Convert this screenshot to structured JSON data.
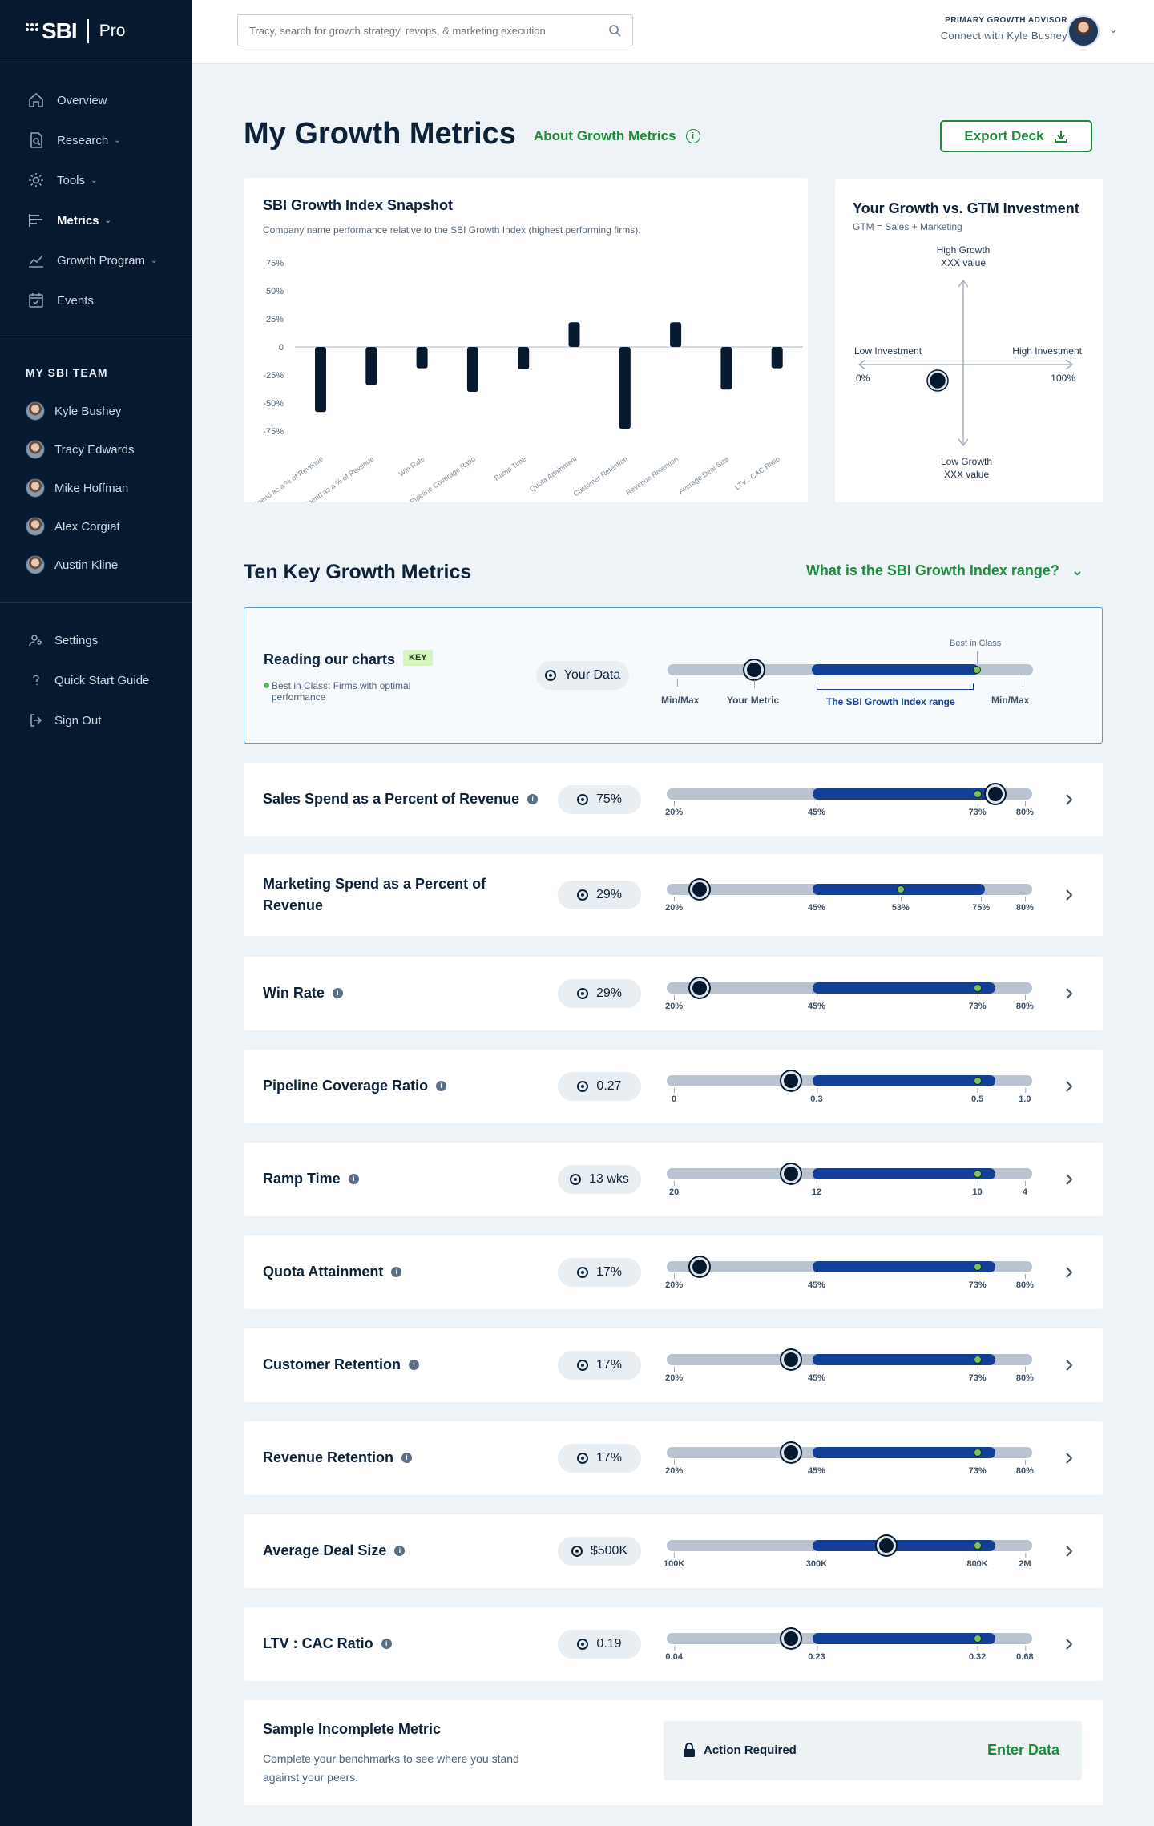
{
  "brand": {
    "name": "SBI",
    "product": "Pro"
  },
  "nav": [
    {
      "label": "Overview",
      "icon": "home-icon",
      "chevron": false,
      "active": false
    },
    {
      "label": "Research",
      "icon": "document-search-icon",
      "chevron": true,
      "active": false
    },
    {
      "label": "Tools",
      "icon": "gear-icon",
      "chevron": true,
      "active": false
    },
    {
      "label": "Metrics",
      "icon": "bar-list-icon",
      "chevron": true,
      "active": true
    },
    {
      "label": "Growth Program",
      "icon": "trend-line-icon",
      "chevron": true,
      "active": false
    },
    {
      "label": "Events",
      "icon": "calendar-icon",
      "chevron": false,
      "active": false
    }
  ],
  "team": {
    "heading": "MY SBI TEAM",
    "members": [
      "Kyle Bushey",
      "Tracy Edwards",
      "Mike Hoffman",
      "Alex Corgiat",
      "Austin Kline"
    ]
  },
  "bottom_nav": [
    {
      "label": "Settings",
      "icon": "user-gear-icon"
    },
    {
      "label": "Quick Start Guide",
      "icon": "question-icon"
    },
    {
      "label": "Sign Out",
      "icon": "sign-out-icon"
    }
  ],
  "topbar": {
    "search_placeholder": "Tracy, search for growth strategy, revops, & marketing execution",
    "advisor_label": "PRIMARY GROWTH ADVISOR",
    "advisor_connect": "Connect with Kyle Bushey"
  },
  "page": {
    "title": "My Growth Metrics",
    "about_link": "About Growth Metrics",
    "export_label": "Export Deck"
  },
  "snapshot": {
    "title": "SBI Growth Index Snapshot",
    "subtitle": "Company name performance relative to the SBI Growth Index (highest performing firms)."
  },
  "chart_data": {
    "type": "bar",
    "title": "SBI Growth Index Snapshot",
    "yticks": [
      "75%",
      "50%",
      "25%",
      "0",
      "-25%",
      "-50%",
      "-75%"
    ],
    "ylim": [
      -75,
      75
    ],
    "categories": [
      "Sales Spend as a % of Revenue",
      "Marketing Spend as a % of Revenue",
      "Win Rate",
      "Pipeline Coverage Ratio",
      "Ramp Time",
      "Quota Attainment",
      "Customer Retention",
      "Revenue Retention",
      "Average Deal Size",
      "LTV : CAC Ratio"
    ],
    "values": [
      -58,
      -34,
      -19,
      -40,
      -20,
      22,
      -73,
      22,
      -38,
      -19
    ]
  },
  "gtm": {
    "title": "Your Growth vs. GTM Investment",
    "subtitle": "GTM = Sales + Marketing",
    "high_growth": "High Growth",
    "high_value": "XXX value",
    "low_growth": "Low Growth",
    "low_value": "XXX value",
    "low_investment": "Low Investment",
    "high_investment": "High Investment",
    "zero": "0%",
    "hundred": "100%"
  },
  "section": {
    "title": "Ten Key Growth Metrics",
    "range_question": "What is the SBI Growth Index range?"
  },
  "key": {
    "title": "Reading our charts",
    "tag": "KEY",
    "best_in_class": "Best in Class: Firms with optimal performance",
    "your_data": "Your Data",
    "best_label": "Best in Class",
    "min_max_left": "Min/Max",
    "your_metric": "Your Metric",
    "range_label": "The SBI Growth Index range",
    "min_max_right": "Min/Max"
  },
  "metrics": [
    {
      "name": "Sales Spend as a Percent of Revenue",
      "info": true,
      "value": "75%",
      "you": 0.9,
      "bic": 0.85,
      "range_end": 0.9,
      "ticks": [
        "20%",
        "45%",
        "73%",
        "80%"
      ],
      "tick_pos": [
        0.02,
        0.41,
        0.85,
        0.98
      ]
    },
    {
      "name": "Marketing Spend as a Percent of Revenue",
      "info": false,
      "value": "29%",
      "you": 0.09,
      "bic": 0.64,
      "range_end": 0.87,
      "ticks": [
        "20%",
        "45%",
        "53%",
        "75%",
        "80%"
      ],
      "tick_pos": [
        0.02,
        0.41,
        0.64,
        0.86,
        0.98
      ]
    },
    {
      "name": "Win Rate",
      "info": true,
      "value": "29%",
      "you": 0.09,
      "bic": 0.85,
      "range_end": 0.9,
      "ticks": [
        "20%",
        "45%",
        "73%",
        "80%"
      ],
      "tick_pos": [
        0.02,
        0.41,
        0.85,
        0.98
      ]
    },
    {
      "name": "Pipeline Coverage Ratio",
      "info": true,
      "value": "0.27",
      "you": 0.34,
      "bic": 0.85,
      "range_end": 0.9,
      "ticks": [
        "0",
        "0.3",
        "0.5",
        "1.0"
      ],
      "tick_pos": [
        0.02,
        0.41,
        0.85,
        0.98
      ]
    },
    {
      "name": "Ramp Time",
      "info": true,
      "value": "13 wks",
      "you": 0.34,
      "bic": 0.85,
      "range_end": 0.9,
      "ticks": [
        "20",
        "12",
        "10",
        "4"
      ],
      "tick_pos": [
        0.02,
        0.41,
        0.85,
        0.98
      ]
    },
    {
      "name": "Quota Attainment",
      "info": true,
      "value": "17%",
      "you": 0.09,
      "bic": 0.85,
      "range_end": 0.9,
      "ticks": [
        "20%",
        "45%",
        "73%",
        "80%"
      ],
      "tick_pos": [
        0.02,
        0.41,
        0.85,
        0.98
      ]
    },
    {
      "name": "Customer Retention",
      "info": true,
      "value": "17%",
      "you": 0.34,
      "bic": 0.85,
      "range_end": 0.9,
      "ticks": [
        "20%",
        "45%",
        "73%",
        "80%"
      ],
      "tick_pos": [
        0.02,
        0.41,
        0.85,
        0.98
      ]
    },
    {
      "name": "Revenue Retention",
      "info": true,
      "value": "17%",
      "you": 0.34,
      "bic": 0.85,
      "range_end": 0.9,
      "ticks": [
        "20%",
        "45%",
        "73%",
        "80%"
      ],
      "tick_pos": [
        0.02,
        0.41,
        0.85,
        0.98
      ]
    },
    {
      "name": "Average Deal Size",
      "info": true,
      "value": "$500K",
      "you": 0.6,
      "bic": 0.85,
      "range_end": 0.9,
      "ticks": [
        "100K",
        "300K",
        "800K",
        "2M"
      ],
      "tick_pos": [
        0.02,
        0.41,
        0.85,
        0.98
      ]
    },
    {
      "name": "LTV : CAC Ratio",
      "info": true,
      "value": "0.19",
      "you": 0.34,
      "bic": 0.85,
      "range_end": 0.9,
      "ticks": [
        "0.04",
        "0.23",
        "0.32",
        "0.68"
      ],
      "tick_pos": [
        0.02,
        0.41,
        0.85,
        0.98
      ]
    }
  ],
  "incomplete": {
    "title": "Sample Incomplete Metric",
    "description": "Complete your benchmarks to see where you stand against your peers.",
    "action": "Action Required",
    "button": "Enter Data"
  },
  "colors": {
    "accent": "#1f8a3b",
    "navy": "#06192e",
    "range_blue": "#133f96",
    "best_green": "#79c364"
  }
}
